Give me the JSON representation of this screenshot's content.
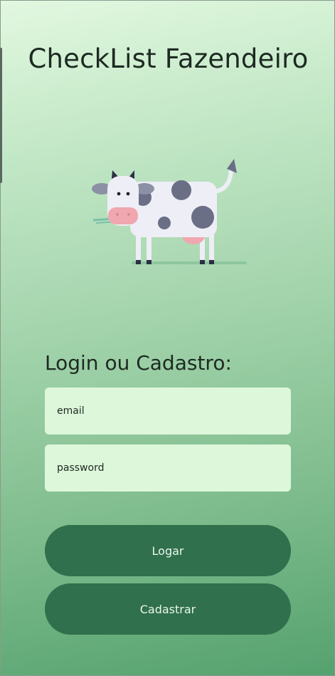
{
  "app": {
    "title": "CheckList Fazendeiro"
  },
  "illustration": {
    "icon": "cow-icon"
  },
  "form": {
    "heading": "Login ou Cadastro:",
    "email_placeholder": "email",
    "password_placeholder": "password"
  },
  "buttons": {
    "login_label": "Logar",
    "register_label": "Cadastrar"
  },
  "colors": {
    "button_bg": "#30704c",
    "field_bg": "#ddf7da",
    "title_text": "#1d2a22"
  }
}
